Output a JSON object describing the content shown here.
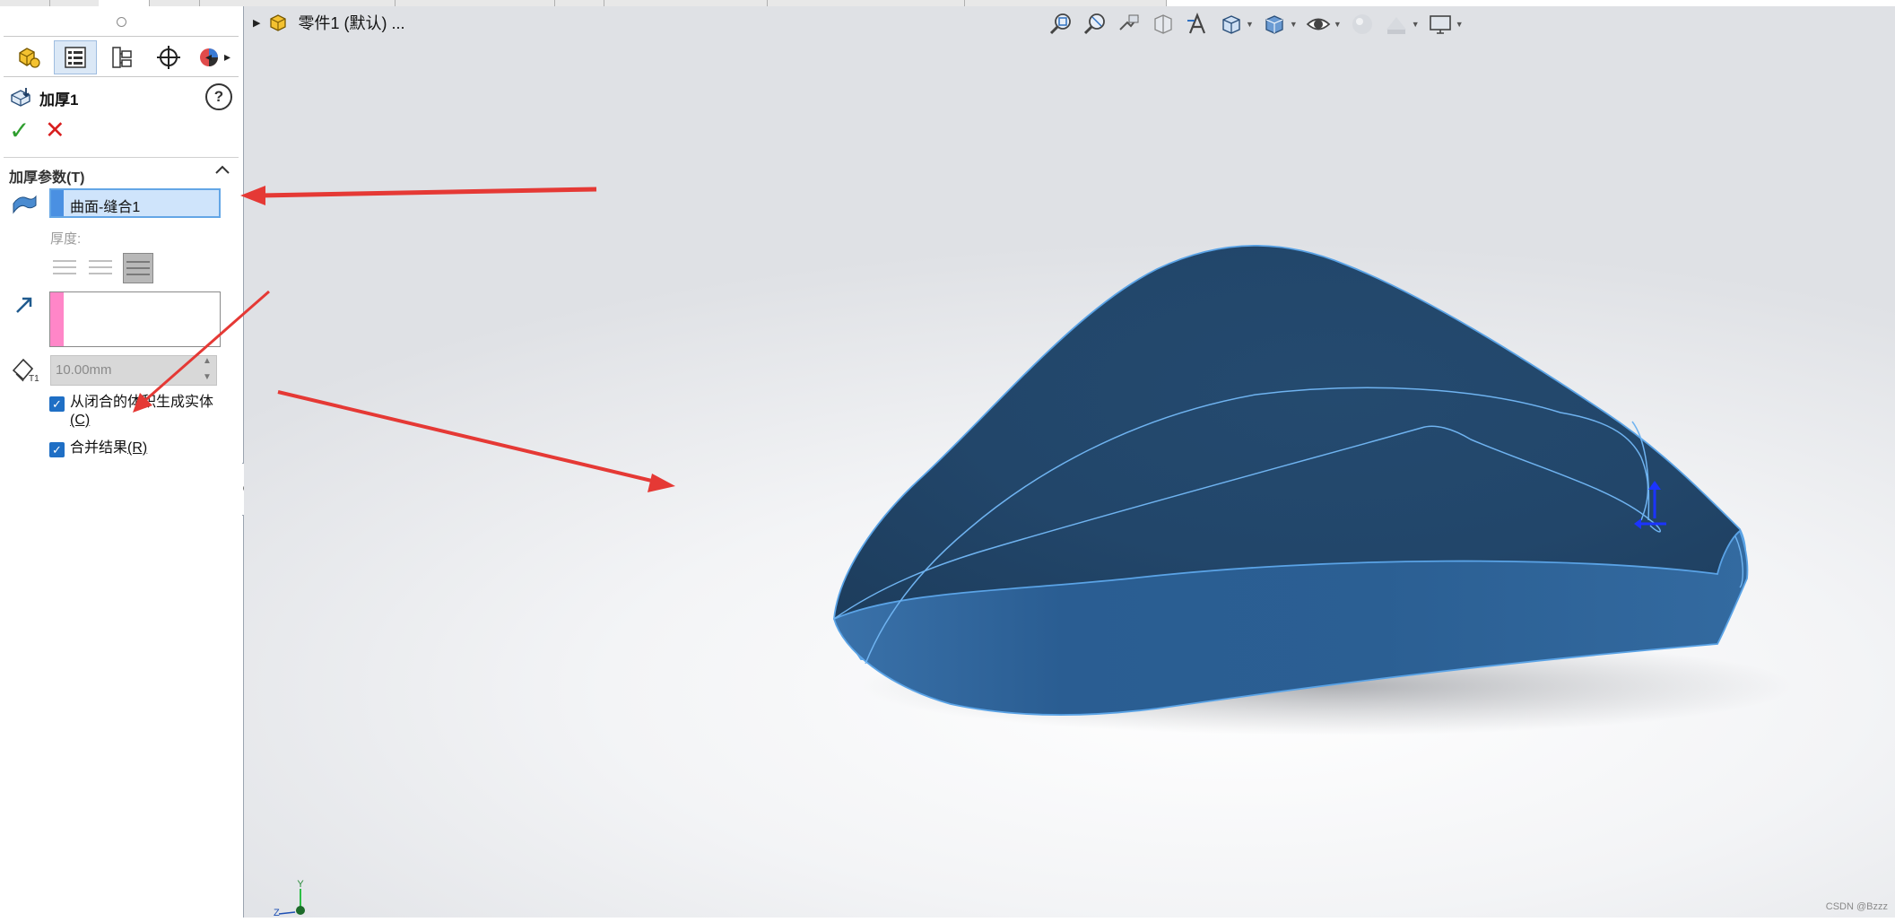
{
  "document": {
    "tree_label": "零件1 (默认) ..."
  },
  "property_manager": {
    "tabs": [
      {
        "icon": "feature-manager-icon"
      },
      {
        "icon": "property-manager-icon"
      },
      {
        "icon": "configuration-manager-icon"
      },
      {
        "icon": "dimxpert-icon"
      },
      {
        "icon": "display-manager-icon"
      }
    ],
    "feature_title": "加厚1",
    "group_title": "加厚参数(T)",
    "selection_value": "曲面-缝合1",
    "thickness_label": "厚度:",
    "thickness_value": "10.00mm",
    "checkbox_solid_label": "从闭合的体积生成实体",
    "checkbox_solid_tail": "(C)",
    "checkbox_merge_label": "合并结果",
    "checkbox_merge_tail": "(R)",
    "checkbox_solid_checked": true,
    "checkbox_merge_checked": true
  },
  "heads_up_toolbar": {
    "buttons": [
      "zoom-to-fit-icon",
      "zoom-to-area-icon",
      "previous-view-icon",
      "section-view-icon",
      "dynamic-annotation-icon",
      "view-orientation-icon",
      "display-style-icon",
      "hide-show-items-icon",
      "edit-appearance-icon",
      "apply-scene-icon",
      "view-settings-icon"
    ]
  },
  "triad": {
    "y_label": "Y",
    "z_label": "Z"
  },
  "watermark": "CSDN @Bzzz",
  "colors": {
    "model_fill": "#2d5c8a",
    "model_edge": "#6fb3f0",
    "selection_blue": "#4a90e2",
    "selection_pink": "#ff86c8",
    "annotation_red": "#e53935",
    "checkbox_blue": "#1f6fc5"
  }
}
